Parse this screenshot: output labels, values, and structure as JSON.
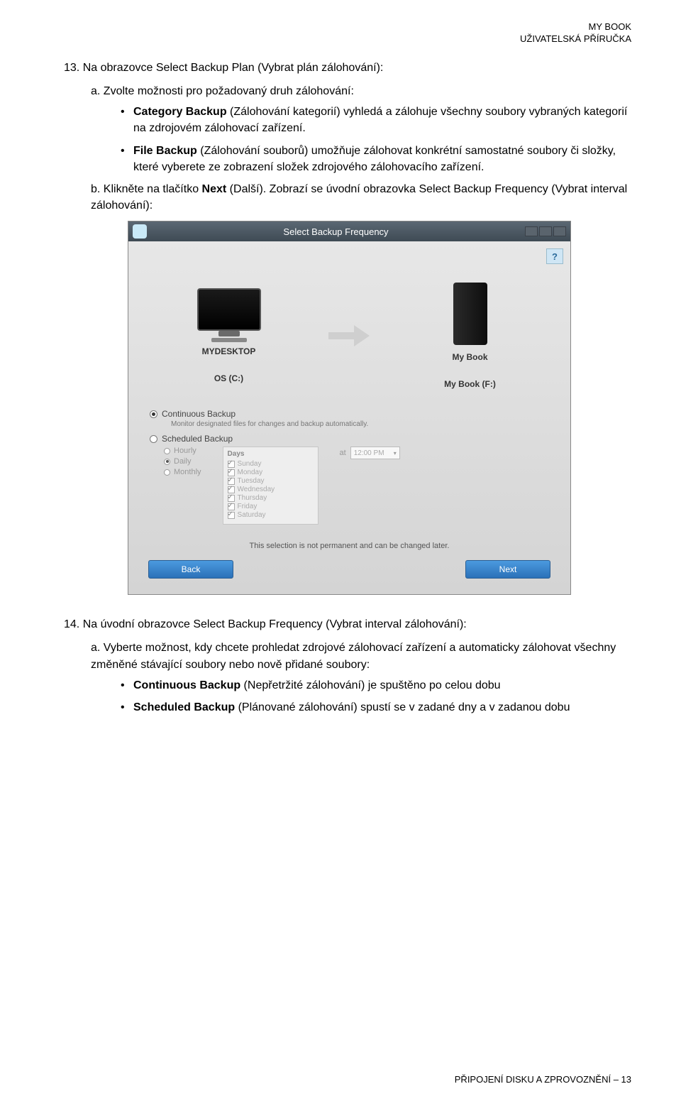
{
  "doc_header": {
    "line1": "MY BOOK",
    "line2": "UŽIVATELSKÁ PŘÍRUČKA"
  },
  "step13": {
    "number": "13.",
    "title": "Na obrazovce Select Backup Plan (Vybrat plán zálohování):",
    "a_label": "a.",
    "a_text": "Zvolte možnosti pro požadovaný druh zálohování:",
    "bullet1_bold": "Category Backup",
    "bullet1_rest": " (Zálohování kategorií) vyhledá a zálohuje všechny soubory vybraných kategorií na zdrojovém zálohovací zařízení.",
    "bullet2_bold": "File Backup",
    "bullet2_rest": " (Zálohování souborů) umožňuje zálohovat konkrétní samostatné soubory či složky, které vyberete ze zobrazení složek zdrojového zálohovacího zařízení.",
    "b_label": "b.",
    "b_pre": "Klikněte na tlačítko ",
    "b_bold": "Next",
    "b_post": " (Další). Zobrazí se úvodní obrazovka Select Backup Frequency (Vybrat interval zálohování):"
  },
  "app": {
    "title": "Select Backup Frequency",
    "help": "?",
    "source_name": "MYDESKTOP",
    "source_drive": "OS (C:)",
    "target_name": "My Book",
    "target_drive": "My Book (F:)",
    "continuous_label": "Continuous Backup",
    "continuous_desc": "Monitor designated files for changes and backup automatically.",
    "scheduled_label": "Scheduled Backup",
    "freq": {
      "hourly": "Hourly",
      "daily": "Daily",
      "monthly": "Monthly"
    },
    "days_head": "Days",
    "days": [
      "Sunday",
      "Monday",
      "Tuesday",
      "Wednesday",
      "Thursday",
      "Friday",
      "Saturday"
    ],
    "at": "at",
    "time": "12:00 PM",
    "note": "This selection is not permanent and can be changed later.",
    "back": "Back",
    "next": "Next"
  },
  "step14": {
    "number": "14.",
    "title": "Na úvodní obrazovce Select Backup Frequency (Vybrat interval zálohování):",
    "a_label": "a.",
    "a_text": "Vyberte možnost, kdy chcete prohledat zdrojové zálohovací zařízení a automaticky zálohovat všechny změněné stávající soubory nebo nově přidané soubory:",
    "bullet1_bold": "Continuous Backup",
    "bullet1_rest": " (Nepřetržité zálohování) je spuštěno po celou dobu",
    "bullet2_bold": "Scheduled Backup",
    "bullet2_rest": " (Plánované zálohování) spustí se v zadané dny a v zadanou dobu"
  },
  "footer": {
    "text": "PŘIPOJENÍ DISKU A ZPROVOZNĚNÍ – 13"
  }
}
